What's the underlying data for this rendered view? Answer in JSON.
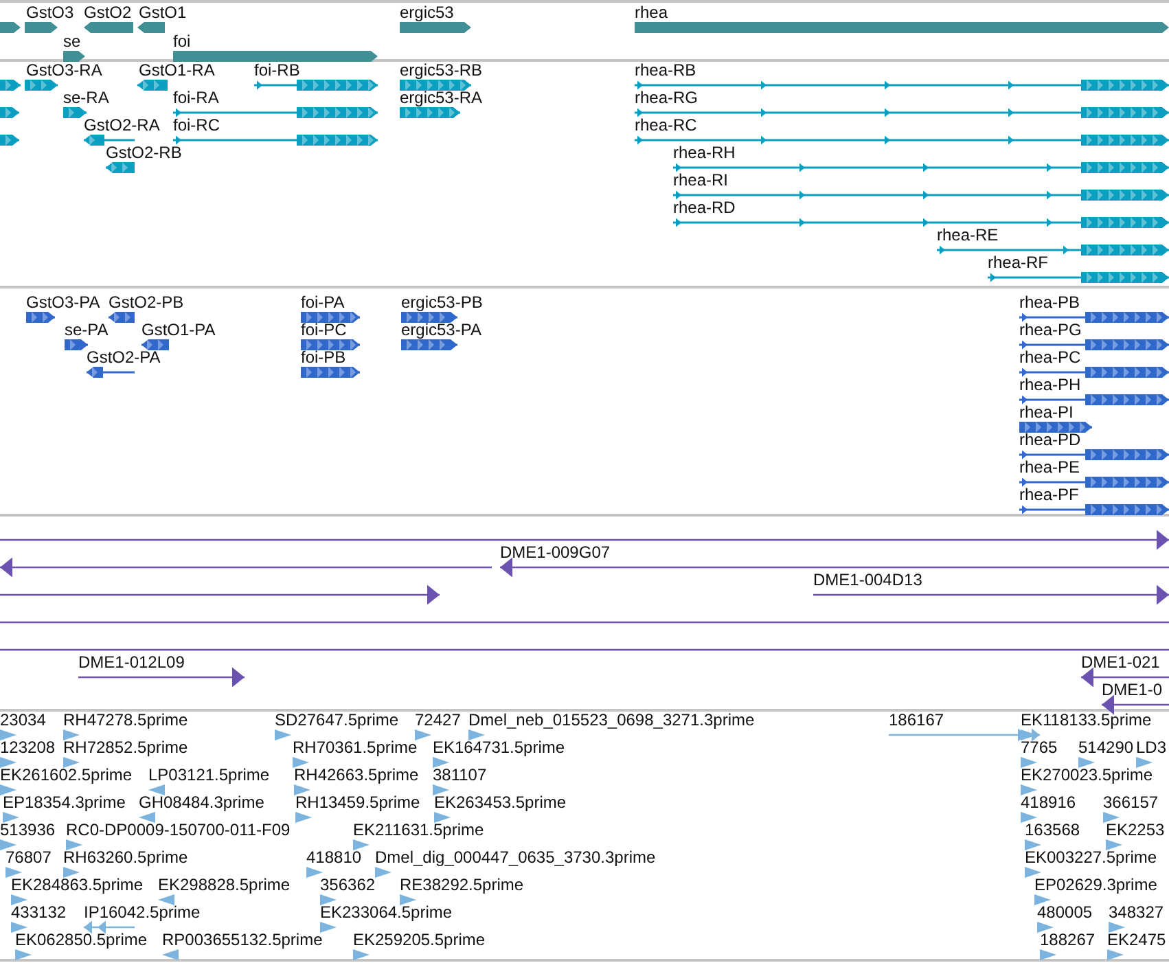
{
  "tracks": [
    {
      "kind": "gene",
      "color": "#3f8f94",
      "lanes": [
        [
          {
            "reverse": false
          },
          {
            "label": "GstO3",
            "reverse": false
          },
          {
            "label": "GstO2",
            "reverse": true
          },
          {
            "label": "GstO1",
            "reverse": true
          },
          {
            "label": "ergic53",
            "reverse": false
          },
          {
            "label": "rhea",
            "reverse": false
          }
        ],
        [
          {
            "label": "se",
            "reverse": false
          },
          {
            "label": "foi",
            "reverse": false
          }
        ]
      ]
    },
    {
      "kind": "transcript",
      "color": "#0b9fc2",
      "lanes": [
        [
          {
            "reverse": false
          },
          {
            "label": "GstO3-RA",
            "reverse": false
          },
          {
            "label": "GstO1-RA",
            "reverse": true
          },
          {
            "label": "foi-RB",
            "reverse": false
          },
          {
            "label": "ergic53-RB",
            "reverse": false
          },
          {
            "label": "rhea-RB",
            "reverse": false
          }
        ],
        [
          {
            "reverse": false
          },
          {
            "label": "se-RA",
            "reverse": false
          },
          {
            "label": "foi-RA",
            "reverse": false
          },
          {
            "label": "ergic53-RA",
            "reverse": false
          },
          {
            "label": "rhea-RG",
            "reverse": false
          }
        ],
        [
          {
            "reverse": false
          },
          {
            "label": "GstO2-RA",
            "reverse": true
          },
          {
            "label": "foi-RC",
            "reverse": false
          },
          {
            "label": "rhea-RC",
            "reverse": false
          }
        ],
        [
          {
            "label": "GstO2-RB",
            "reverse": true
          },
          {
            "label": "rhea-RH",
            "reverse": false
          }
        ],
        [
          {
            "label": "rhea-RI",
            "reverse": false
          }
        ],
        [
          {
            "label": "rhea-RD",
            "reverse": false
          }
        ],
        [
          {
            "label": "rhea-RE",
            "reverse": false
          }
        ],
        [
          {
            "label": "rhea-RF",
            "reverse": false
          }
        ]
      ]
    },
    {
      "kind": "protein",
      "color": "#3168cc",
      "lanes": [
        [
          {
            "label": "GstO3-PA",
            "reverse": false
          },
          {
            "label": "GstO2-PB",
            "reverse": true
          },
          {
            "label": "foi-PA",
            "reverse": false
          },
          {
            "label": "ergic53-PB",
            "reverse": false
          },
          {
            "label": "rhea-PB",
            "reverse": false
          }
        ],
        [
          {
            "label": "se-PA",
            "reverse": false
          },
          {
            "label": "GstO1-PA",
            "reverse": true
          },
          {
            "label": "foi-PC",
            "reverse": false
          },
          {
            "label": "ergic53-PA",
            "reverse": false
          },
          {
            "label": "rhea-PG",
            "reverse": false
          }
        ],
        [
          {
            "label": "GstO2-PA",
            "reverse": true
          },
          {
            "label": "foi-PB",
            "reverse": false
          },
          {
            "label": "rhea-PC",
            "reverse": false
          }
        ],
        [
          {
            "label": "rhea-PH",
            "reverse": false
          }
        ],
        [
          {
            "label": "rhea-PI",
            "reverse": false
          }
        ],
        [
          {
            "label": "rhea-PD",
            "reverse": false
          }
        ],
        [
          {
            "label": "rhea-PE",
            "reverse": false
          }
        ],
        [
          {
            "label": "rhea-PF",
            "reverse": false
          }
        ]
      ]
    },
    {
      "kind": "clone",
      "color": "#6b52b0",
      "lanes": [
        [
          {
            "reverse": false
          }
        ],
        [
          {
            "reverse": true
          },
          {
            "label": "DME1-009G07",
            "reverse": true
          }
        ],
        [
          {
            "reverse": false
          },
          {
            "label": "DME1-004D13",
            "reverse": false
          }
        ],
        [
          {
            "kind": "continuous"
          }
        ],
        [
          {
            "kind": "continuous"
          }
        ],
        [
          {
            "label": "DME1-012L09",
            "reverse": false
          },
          {
            "label": "DME1-021",
            "reverse": true
          }
        ],
        [
          {
            "label": "DME1-0",
            "reverse": true
          }
        ]
      ]
    },
    {
      "kind": "est",
      "color": "#7db4dd",
      "lanes": [
        [
          {
            "label": "23034",
            "reverse": false
          },
          {
            "label": "RH47278.5prime",
            "reverse": false
          },
          {
            "label": "SD27647.5prime",
            "reverse": false
          },
          {
            "label": "72427",
            "reverse": false
          },
          {
            "label": "Dmel_neb_015523_0698_3271.3prime",
            "reverse": false
          },
          {
            "label": "186167",
            "reverse": false
          },
          {
            "label": "EK118133.5prime",
            "reverse": false
          }
        ],
        [
          {
            "label": "123208",
            "reverse": false
          },
          {
            "label": "RH72852.5prime",
            "reverse": false
          },
          {
            "label": "RH70361.5prime",
            "reverse": false
          },
          {
            "label": "EK164731.5prime",
            "reverse": false
          },
          {
            "label": "7765",
            "reverse": false
          },
          {
            "label": "514290",
            "reverse": false
          },
          {
            "label": "LD3",
            "reverse": false
          }
        ],
        [
          {
            "label": "EK261602.5prime",
            "reverse": false
          },
          {
            "label": "LP03121.5prime",
            "reverse": true
          },
          {
            "label": "RH42663.5prime",
            "reverse": false
          },
          {
            "label": "381107",
            "reverse": false
          },
          {
            "label": "EK270023.5prime",
            "reverse": false
          }
        ],
        [
          {
            "label": "EP18354.3prime",
            "reverse": false
          },
          {
            "label": "GH08484.3prime",
            "reverse": true
          },
          {
            "label": "RH13459.5prime",
            "reverse": false
          },
          {
            "label": "EK263453.5prime",
            "reverse": false
          },
          {
            "label": "418916",
            "reverse": false
          },
          {
            "label": "366157",
            "reverse": false
          }
        ],
        [
          {
            "label": "513936",
            "reverse": false
          },
          {
            "label": "RC0-DP0009-150700-011-F09",
            "reverse": false
          },
          {
            "label": "EK211631.5prime",
            "reverse": false
          },
          {
            "label": "163568",
            "reverse": false
          },
          {
            "label": "EK2253",
            "reverse": false
          }
        ],
        [
          {
            "label": "76807",
            "reverse": false
          },
          {
            "label": "RH63260.5prime",
            "reverse": false
          },
          {
            "label": "418810",
            "reverse": false
          },
          {
            "label": "Dmel_dig_000447_0635_3730.3prime",
            "reverse": false
          },
          {
            "label": "EK003227.5prime",
            "reverse": false
          }
        ],
        [
          {
            "label": "EK284863.5prime",
            "reverse": false
          },
          {
            "label": "EK298828.5prime",
            "reverse": true
          },
          {
            "label": "356362",
            "reverse": false
          },
          {
            "label": "RE38292.5prime",
            "reverse": false
          },
          {
            "label": "EP02629.3prime",
            "reverse": false
          }
        ],
        [
          {
            "label": "433132",
            "reverse": false
          },
          {
            "label": "IP16042.5prime",
            "reverse": true
          },
          {
            "label": "EK233064.5prime",
            "reverse": false
          },
          {
            "label": "480005",
            "reverse": false
          },
          {
            "label": "348327",
            "reverse": false
          }
        ],
        [
          {
            "label": "EK062850.5prime",
            "reverse": false
          },
          {
            "label": "RP003655132.5prime",
            "reverse": true
          },
          {
            "label": "EK259205.5prime",
            "reverse": false
          },
          {
            "label": "188267",
            "reverse": false
          },
          {
            "label": "EK2475",
            "reverse": false
          }
        ]
      ]
    }
  ]
}
